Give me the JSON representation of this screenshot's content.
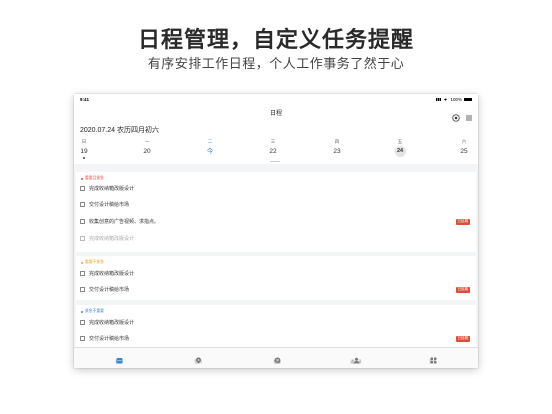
{
  "hero": {
    "title": "日程管理，自定义任务提醒",
    "subtitle": "有序安排工作日程，个人工作事务了然于心"
  },
  "statusbar": {
    "time": "9:41",
    "battery": "100%"
  },
  "navbar": {
    "title": "日程",
    "left_icon": "add-circle-icon",
    "right_icon": "menu-icon"
  },
  "date_header": "2020.07.24  农历四月初六",
  "week": {
    "days": [
      {
        "weekday": "日",
        "date": "19",
        "has_dot": true
      },
      {
        "weekday": "一",
        "date": "20",
        "has_dot": false
      },
      {
        "weekday": "二",
        "date": "今",
        "has_dot": false,
        "today": true
      },
      {
        "weekday": "三",
        "date": "22",
        "has_dot": false
      },
      {
        "weekday": "四",
        "date": "23",
        "has_dot": false
      },
      {
        "weekday": "五",
        "date": "24",
        "has_dot": false,
        "selected": true
      },
      {
        "weekday": "六",
        "date": "25",
        "has_dot": false
      }
    ]
  },
  "groups": [
    {
      "label": "重要且紧急",
      "color": "#e04b3c",
      "tasks": [
        {
          "text": "完成收纳箱改版设计",
          "done": false,
          "tag": ""
        },
        {
          "text": "交付设计稿给市场",
          "done": false,
          "tag": ""
        },
        {
          "text": "收集创意的广告视频、求指点。",
          "done": false,
          "tag": "已延期"
        },
        {
          "text": "完成收纳箱改版设计",
          "done": true,
          "tag": ""
        }
      ]
    },
    {
      "label": "重要不紧急",
      "color": "#f0a020",
      "tasks": [
        {
          "text": "完成收纳箱改版设计",
          "done": false,
          "tag": ""
        },
        {
          "text": "交付设计稿给市场",
          "done": false,
          "tag": "已延期"
        }
      ]
    },
    {
      "label": "紧急不重要",
      "color": "#3b86d6",
      "tasks": [
        {
          "text": "完成收纳箱改版设计",
          "done": false,
          "tag": ""
        },
        {
          "text": "交付设计稿给市场",
          "done": false,
          "tag": "已延期"
        }
      ]
    }
  ],
  "tabs": [
    {
      "label": "日程",
      "icon": "calendar-icon",
      "active": true
    },
    {
      "label": "签到",
      "icon": "location-icon",
      "active": false
    },
    {
      "label": "日志",
      "icon": "log-icon",
      "active": false
    },
    {
      "label": "通讯录",
      "icon": "contacts-icon",
      "active": false
    },
    {
      "label": "更多",
      "icon": "grid-icon",
      "active": false
    }
  ],
  "colors": {
    "accent": "#3b86d6",
    "overdue": "#e04b3c"
  }
}
